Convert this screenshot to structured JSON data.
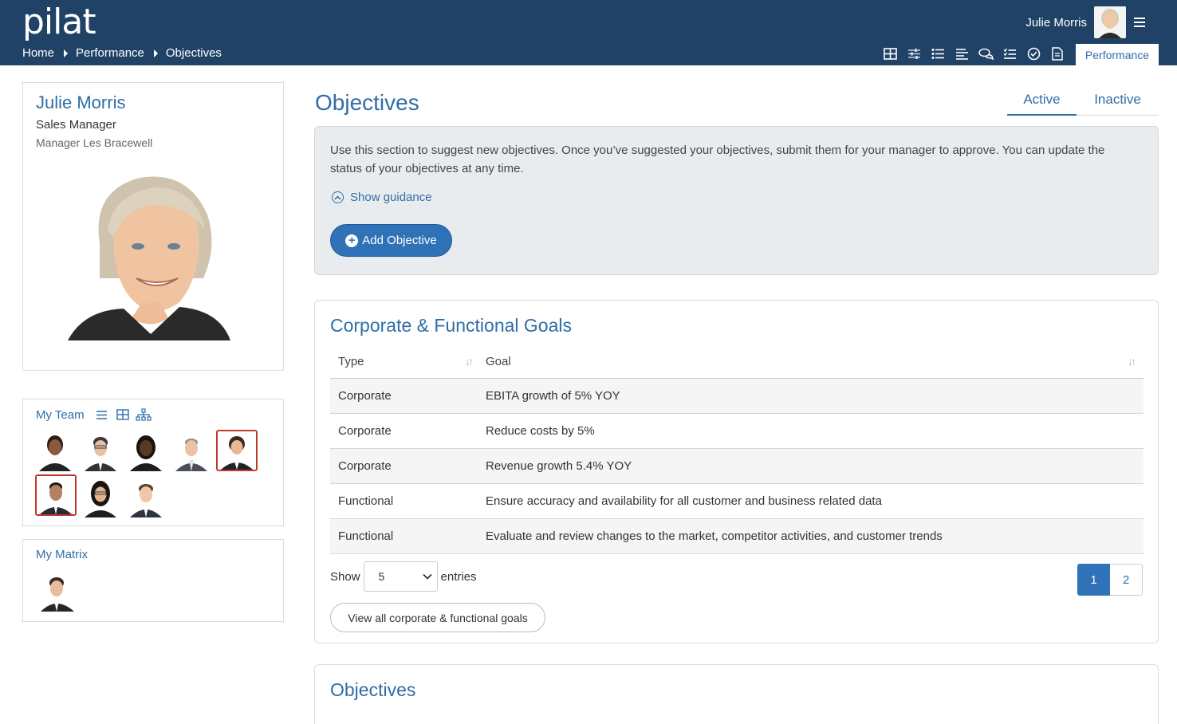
{
  "header": {
    "logo": "pilat",
    "breadcrumb": [
      "Home",
      "Performance",
      "Objectives"
    ],
    "user_name": "Julie Morris",
    "active_module": "Performance",
    "toolbar_icons": [
      "grid-icon",
      "sliders-icon",
      "list-icon",
      "align-left-icon",
      "chat-icon",
      "checklist-icon",
      "check-circle-icon",
      "document-icon"
    ],
    "bar_color": "#1f4266"
  },
  "profile": {
    "name": "Julie Morris",
    "title": "Sales Manager",
    "manager": "Manager Les Bracewell"
  },
  "team": {
    "title": "My Team",
    "tools": [
      "list-view-icon",
      "grid-view-icon",
      "org-chart-icon"
    ]
  },
  "matrix": {
    "title": "My Matrix"
  },
  "main": {
    "title": "Objectives",
    "tabs": [
      "Active",
      "Inactive"
    ],
    "info_text": "Use this section to suggest new objectives. Once you’ve suggested your objectives, submit them for your manager to approve. You can update the status of your objectives at any time.",
    "guidance_link": "Show guidance",
    "add_button": "Add Objective"
  },
  "goals": {
    "title": "Corporate & Functional Goals",
    "columns": [
      "Type",
      "Goal"
    ],
    "rows": [
      {
        "type": "Corporate",
        "goal": "EBITA growth of 5% YOY"
      },
      {
        "type": "Corporate",
        "goal": "Reduce costs by 5%"
      },
      {
        "type": "Corporate",
        "goal": "Revenue growth 5.4% YOY"
      },
      {
        "type": "Functional",
        "goal": "Ensure accuracy and availability for all customer and business related data"
      },
      {
        "type": "Functional",
        "goal": "Evaluate and review changes to the market, competitor activities, and customer trends"
      }
    ],
    "show_label": "Show",
    "entries_value": "5",
    "entries_label": "entries",
    "pages": [
      "1",
      "2"
    ],
    "current_page": "1",
    "view_all": "View all corporate & functional goals"
  },
  "objectives": {
    "title": "Objectives"
  },
  "colors": {
    "accent": "#2f6ea7",
    "button": "#2f72b8",
    "selected_border": "#c0392b"
  }
}
